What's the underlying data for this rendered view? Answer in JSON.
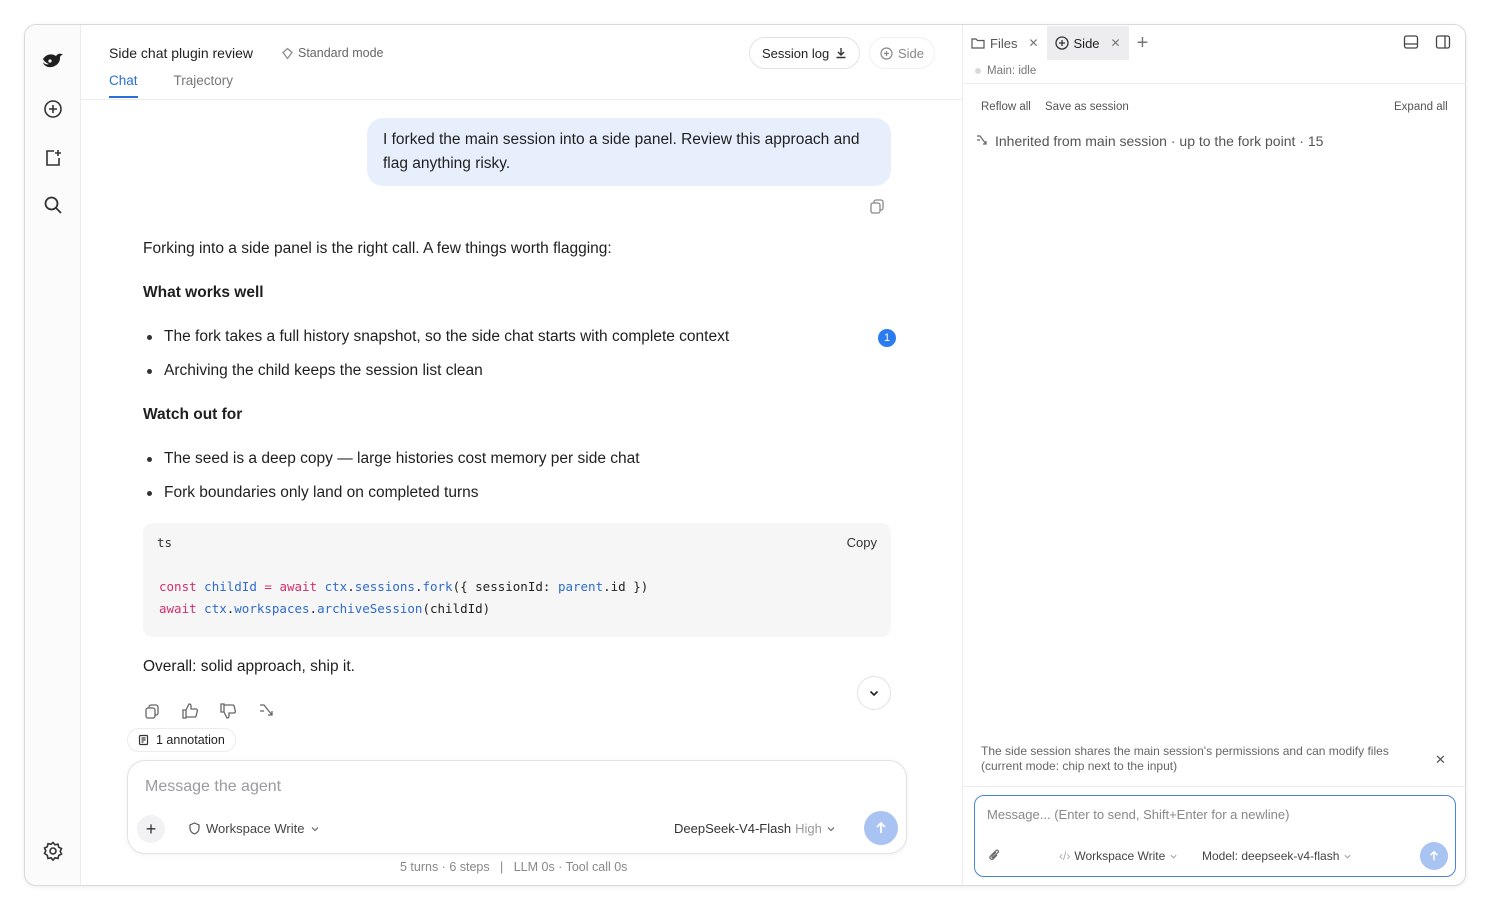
{
  "header": {
    "title": "Side chat plugin review",
    "mode": "Standard mode",
    "session_log": "Session log",
    "side": "Side"
  },
  "tabs": [
    "Chat",
    "Trajectory"
  ],
  "user_message": "I forked the main session into a side panel. Review this approach and flag anything risky.",
  "response": {
    "intro": "Forking into a side panel is the right call. A few things worth flagging:",
    "h1": "What works well",
    "works": [
      "The fork takes a full history snapshot, so the side chat starts with complete context",
      "Archiving the child keeps the session list clean"
    ],
    "badge": "1",
    "h2": "Watch out for",
    "watch": [
      "The seed is a deep copy — large histories cost memory per side chat",
      "Fork boundaries only land on completed turns"
    ],
    "code_lang": "ts",
    "code_copy": "Copy",
    "code": {
      "l1_kw1": "const",
      "l1_var": "childId",
      "l1_eq": " = ",
      "l1_kw2": "await",
      "l1_obj": "ctx",
      "l1_dot1": ".",
      "l1_prop": "sessions",
      "l1_dot2": ".",
      "l1_fn": "fork",
      "l1_rest1": "({ sessionId: ",
      "l1_par": "parent",
      "l1_rest2": ".id })",
      "l2_kw": "await",
      "l2_obj": "ctx",
      "l2_dot1": ".",
      "l2_prop": "workspaces",
      "l2_dot2": ".",
      "l2_fn": "archiveSession",
      "l2_rest": "(childId)"
    },
    "conclusion": "Overall: solid approach, ship it."
  },
  "annotation": "1 annotation",
  "composer": {
    "placeholder": "Message the agent",
    "permission": "Workspace Write",
    "model": "DeepSeek-V4-Flash",
    "effort": "High"
  },
  "stats": "5 turns · 6 steps   |   LLM 0s · Tool call 0s",
  "right_panel": {
    "tabs": [
      "Files",
      "Side"
    ],
    "status": "Main: idle",
    "reflow": "Reflow all",
    "save": "Save as session",
    "expand": "Expand all",
    "inherited": "Inherited from main session · up to the fork point · 15",
    "note": "The side session shares the main session's permissions and can modify files (current mode: chip next to the input)",
    "composer_placeholder": "Message... (Enter to send, Shift+Enter for a newline)",
    "permission": "Workspace Write",
    "model": "Model: deepseek-v4-flash"
  },
  "colors": {
    "accent": "#2b6fd6",
    "user_bubble": "#e8effc",
    "send_disabled": "#a9c3f3",
    "badge": "#2b7cf0"
  }
}
